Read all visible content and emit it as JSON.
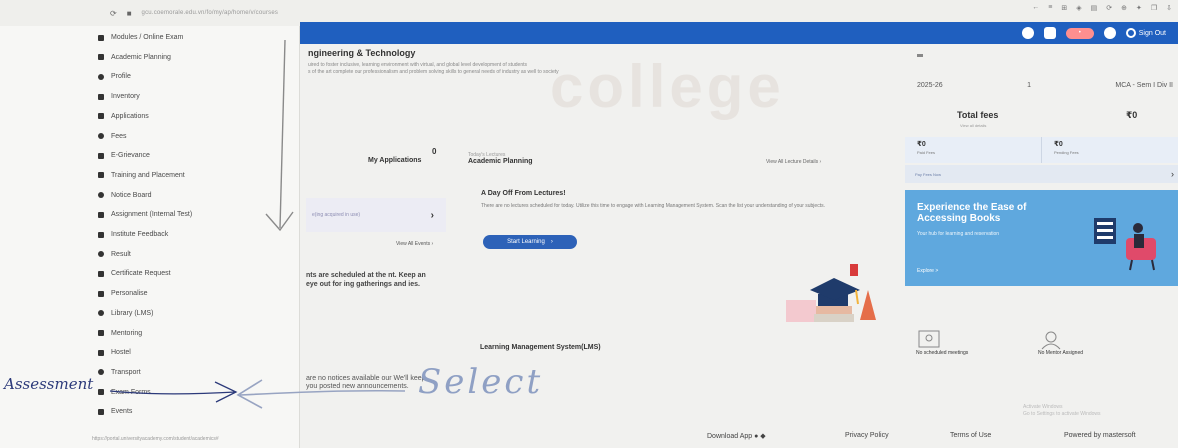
{
  "browser": {
    "url": "gcu.coemorale.edu.vn/fo/my/ap/home/v/courses",
    "icons": [
      "←",
      "≡",
      "⊞",
      "◈",
      "▤",
      "⟳",
      "⊕",
      "✦",
      "❐",
      "⇩"
    ]
  },
  "header": {
    "sign_out": "Sign Out"
  },
  "sidebar": {
    "items": [
      {
        "label": "Modules / Online Exam",
        "icon": "modules-icon"
      },
      {
        "label": "Academic Planning",
        "icon": "planning-icon"
      },
      {
        "label": "Profile",
        "icon": "profile-icon"
      },
      {
        "label": "Inventory",
        "icon": "inventory-icon"
      },
      {
        "label": "Applications",
        "icon": "applications-icon"
      },
      {
        "label": "Fees",
        "icon": "fees-icon"
      },
      {
        "label": "E-Grievance",
        "icon": "grievance-icon"
      },
      {
        "label": "Training and Placement",
        "icon": "placement-icon"
      },
      {
        "label": "Notice Board",
        "icon": "notice-icon"
      },
      {
        "label": "Assignment (Internal Test)",
        "icon": "assignment-icon"
      },
      {
        "label": "Institute Feedback",
        "icon": "feedback-icon"
      },
      {
        "label": "Result",
        "icon": "result-icon"
      },
      {
        "label": "Certificate Request",
        "icon": "certificate-icon"
      },
      {
        "label": "Personalise",
        "icon": "personalise-icon"
      },
      {
        "label": "Library (LMS)",
        "icon": "library-icon"
      },
      {
        "label": "Mentoring",
        "icon": "mentoring-icon"
      },
      {
        "label": "Hostel",
        "icon": "hostel-icon"
      },
      {
        "label": "Transport",
        "icon": "transport-icon"
      },
      {
        "label": "Exam Forms",
        "icon": "exam-forms-icon"
      },
      {
        "label": "Events",
        "icon": "events-icon"
      }
    ],
    "status_url": "https://portal.universityacademy.com/student/academics#"
  },
  "main": {
    "college": "ngineering & Technology",
    "tagline_1": "uired to foster inclusive, learning environment with virtual, and global level development of students",
    "tagline_2": "s of the art complete our professionalism and problem solving skills to general needs of industry as well to society",
    "count": "0",
    "my_applications": "My Applications",
    "application_card": "e(ing acquired in use)",
    "view_all_events": "View All Events  ›",
    "events_text": "nts are scheduled at the nt. Keep an eye out for ing gatherings and ies.",
    "notices_text": "are no notices available our We'll keep you posted new announcements.",
    "today_label": "Today's Lectures",
    "academic_planning": "Academic Planning",
    "view_all_lectures": "View All Lecture Details  ›",
    "day_off_title": "A Day Off From Lectures!",
    "day_off_message": "There are no lectures scheduled for today. Utilize this time to engage with Learning Management System. Scan the list your understanding of your subjects.",
    "start_learning": "Start Learning",
    "lms_title": "Learning Management System(LMS)"
  },
  "right": {
    "year": "2025-26",
    "sem": "1",
    "course": "MCA - Sem I Div II",
    "total_fees_label": "Total fees",
    "total_fees_value": "₹0",
    "fees_sub": "View all details",
    "paid_amount": "₹0",
    "paid_label": "Paid Fees",
    "pending_amount": "₹0",
    "pending_label": "Pending Fees",
    "pay_label": "Pay Fees Now",
    "books_title": "Experience the Ease of Accessing Books",
    "books_sub": "Your hub for learning and reservation",
    "books_link": "Explore  >",
    "meetings": "No scheduled meetings",
    "mentor": "No Mentor Assigned",
    "help_1": "Activate Windows",
    "help_2": "Go to Settings to activate Windows"
  },
  "footer": {
    "download_app": "Download App",
    "privacy": "Privacy Policy",
    "terms": "Terms of Use",
    "powered": "Powered by mastersoft"
  },
  "annotations": {
    "assessment": "Assessment",
    "select": "Select"
  },
  "colors": {
    "app_bar": "#1f5fbf",
    "books_card": "#5fa8de",
    "ink": "#2c3a7a"
  }
}
